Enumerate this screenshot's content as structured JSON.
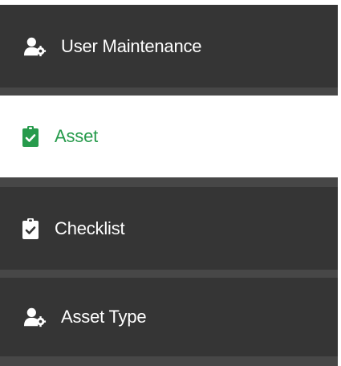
{
  "colors": {
    "item_bg": "#353535",
    "separator": "#474747",
    "active_bg": "#ffffff",
    "active_accent": "#279b4c",
    "text": "#ffffff"
  },
  "menu": {
    "items": [
      {
        "label": "User Maintenance",
        "icon": "user-gear-icon",
        "active": false
      },
      {
        "label": "Asset",
        "icon": "clipboard-check-icon",
        "active": true
      },
      {
        "label": "Checklist",
        "icon": "clipboard-check-icon",
        "active": false
      },
      {
        "label": "Asset Type",
        "icon": "user-gear-icon",
        "active": false
      }
    ]
  }
}
